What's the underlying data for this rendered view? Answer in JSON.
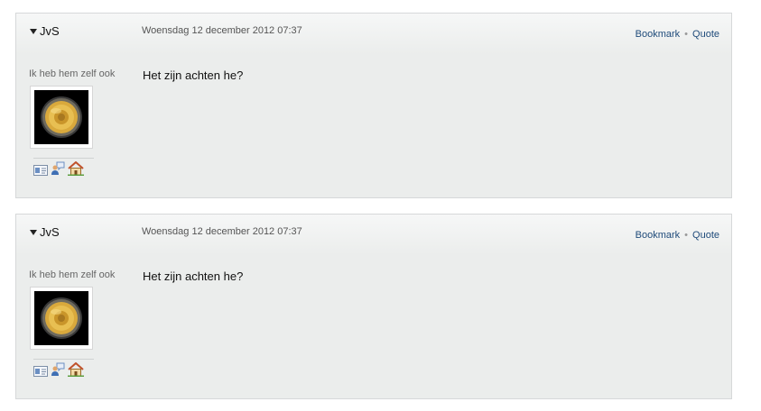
{
  "posts": [
    {
      "author": "JvS",
      "date": "Woensdag 12 december 2012 07:37",
      "actions": {
        "bookmark": "Bookmark",
        "separator": "•",
        "quote": "Quote"
      },
      "user_title": "Ik heb hem zelf ook",
      "message": "Het zijn achten he?",
      "icons": [
        "profile-card-icon",
        "private-message-icon",
        "homepage-icon"
      ]
    },
    {
      "author": "JvS",
      "date": "Woensdag 12 december 2012 07:37",
      "actions": {
        "bookmark": "Bookmark",
        "separator": "•",
        "quote": "Quote"
      },
      "user_title": "Ik heb hem zelf ook",
      "message": "Het zijn achten he?",
      "icons": [
        "profile-card-icon",
        "private-message-icon",
        "homepage-icon"
      ]
    }
  ],
  "colors": {
    "link": "#1f4b7a",
    "panel": "#ebedec",
    "border": "#d6d8d9"
  }
}
